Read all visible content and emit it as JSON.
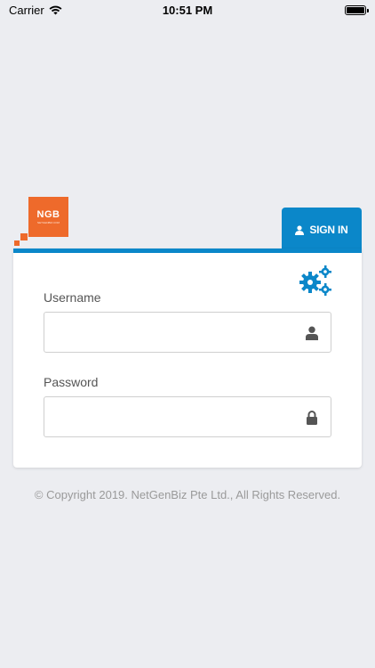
{
  "status_bar": {
    "carrier": "Carrier",
    "time": "10:51 PM"
  },
  "logo": {
    "text": "NGB",
    "subtext": "NETGENBIZ.COM"
  },
  "signin_tab": {
    "label": "SIGN IN",
    "color": "#0b87c9"
  },
  "form": {
    "username_label": "Username",
    "username_value": "",
    "username_icon": "user-icon",
    "password_label": "Password",
    "password_value": "",
    "password_icon": "lock-icon",
    "settings_icon": "gears-icon"
  },
  "footer": {
    "copyright": "© Copyright 2019. NetGenBiz Pte Ltd., All Rights Reserved."
  },
  "colors": {
    "accent": "#0b87c9",
    "brand": "#ee6a2b",
    "background": "#ecedf1"
  }
}
